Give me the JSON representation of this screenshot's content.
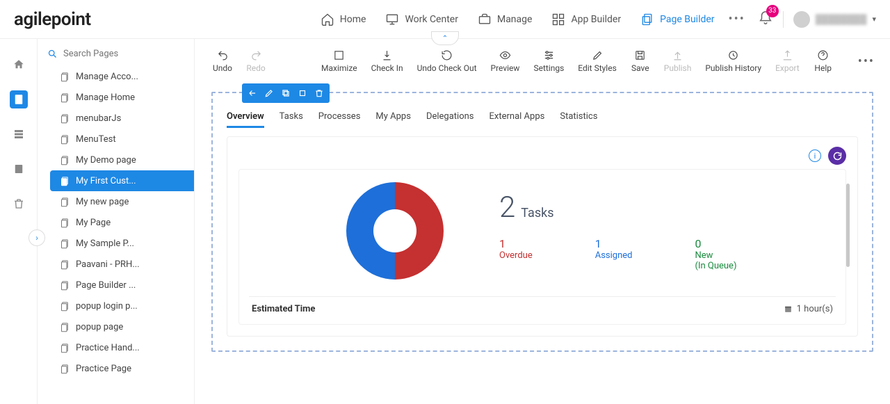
{
  "brand": "agilepoint",
  "nav": {
    "home": "Home",
    "work_center": "Work Center",
    "manage": "Manage",
    "app_builder": "App Builder",
    "page_builder": "Page Builder"
  },
  "notif_count": "33",
  "user_name": "████████",
  "search_placeholder": "Search Pages",
  "pages": [
    "Manage Acco...",
    "Manage Home",
    "menubarJs",
    "MenuTest",
    "My Demo page",
    "My First Cust...",
    "My new page",
    "My Page",
    "My Sample P...",
    "Paavani - PRH...",
    "Page Builder ...",
    "popup login p...",
    "popup page",
    "Practice Hand...",
    "Practice Page"
  ],
  "pages_selected_index": 5,
  "toolbar": {
    "undo": "Undo",
    "redo": "Redo",
    "maximize": "Maximize",
    "check_in": "Check In",
    "undo_checkout": "Undo Check Out",
    "preview": "Preview",
    "settings": "Settings",
    "edit_styles": "Edit Styles",
    "save": "Save",
    "publish": "Publish",
    "publish_history": "Publish History",
    "export": "Export",
    "help": "Help"
  },
  "tabs": [
    "Overview",
    "Tasks",
    "Processes",
    "My Apps",
    "Delegations",
    "External Apps",
    "Statistics"
  ],
  "tabs_active_index": 0,
  "tasks": {
    "count": "2",
    "label": "Tasks",
    "overdue_n": "1",
    "overdue_l": "Overdue",
    "assigned_n": "1",
    "assigned_l": "Assigned",
    "new_n": "0",
    "new_l1": "New",
    "new_l2": "(In Queue)"
  },
  "est": {
    "label": "Estimated Time",
    "value": "1 hour(s)"
  },
  "chart_data": {
    "type": "pie",
    "categories": [
      "Overdue",
      "Assigned"
    ],
    "values": [
      1,
      1
    ],
    "title": "Tasks",
    "colors": [
      "#c53030",
      "#1e6fd9"
    ]
  }
}
